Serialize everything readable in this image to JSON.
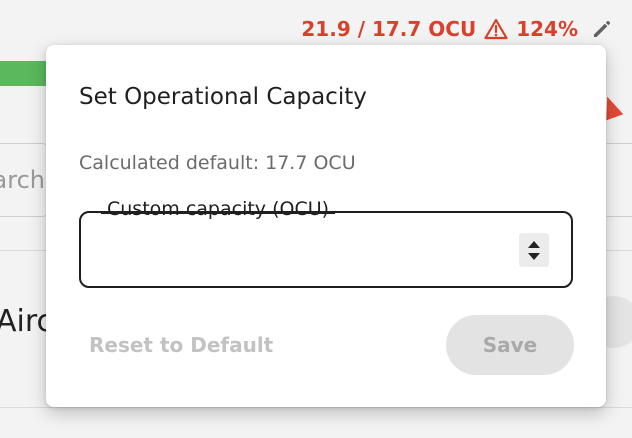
{
  "status": {
    "capacity_text": "21.9 / 17.7 OCU",
    "percent_text": "124%",
    "warning_icon": "warning-triangle-icon",
    "edit_icon": "pencil-icon",
    "alert_color": "#d9412b"
  },
  "background": {
    "search_partial_text": "arch",
    "row_partial_text": "Airc",
    "progress_color": "#5bb85d"
  },
  "modal": {
    "title": "Set Operational Capacity",
    "subtitle": "Calculated default: 17.7 OCU",
    "field": {
      "label": "Custom capacity (OCU)",
      "value": "",
      "placeholder": ""
    },
    "reset_label": "Reset to Default",
    "save_label": "Save"
  }
}
